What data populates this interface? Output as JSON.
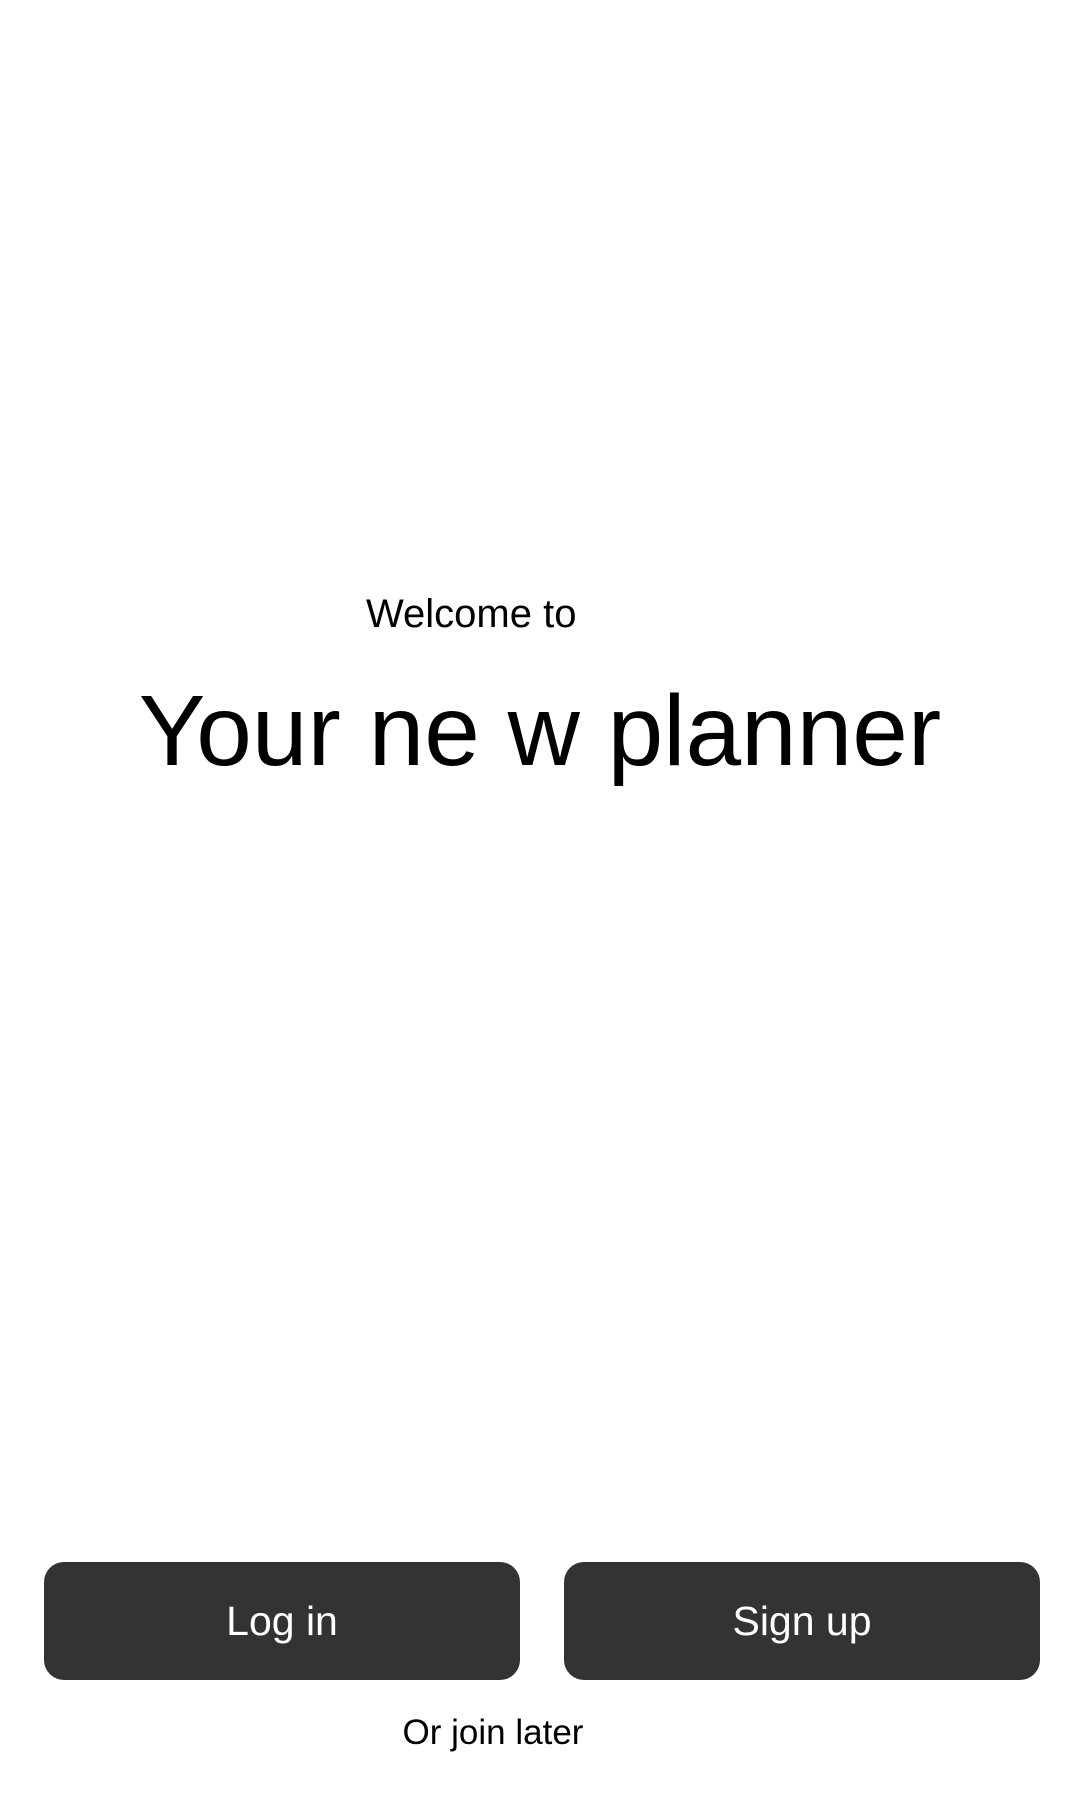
{
  "welcome": {
    "subtitle": "Welcome to",
    "app_name": "Your ne w planner"
  },
  "actions": {
    "login_label": "Log in",
    "signup_label": "Sign up",
    "join_later_label": "Or join later"
  },
  "colors": {
    "background": "#ffffff",
    "button_bg": "#333333",
    "button_text": "#ffffff",
    "text": "#000000"
  }
}
